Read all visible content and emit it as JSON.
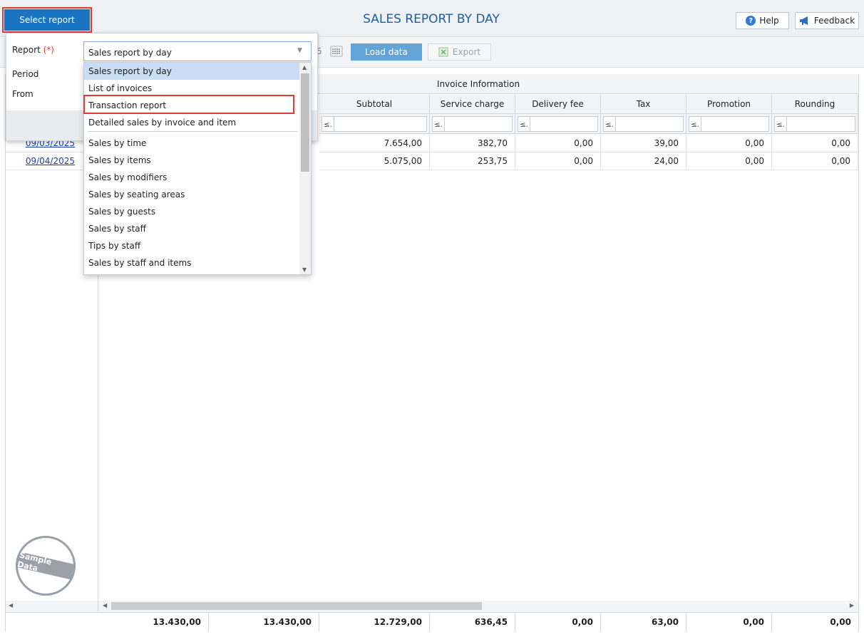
{
  "header": {
    "select_report_label": "Select report",
    "title": "SALES REPORT BY DAY",
    "help_label": "Help",
    "feedback_label": "Feedback"
  },
  "toolbar": {
    "date_tail": "5",
    "load_label": "Load data",
    "export_label": "Export"
  },
  "panel": {
    "report_label": "Report",
    "required_mark": "(*)",
    "period_label": "Period",
    "from_label": "From",
    "report_value": "Sales report by day",
    "dropdown_items": [
      "Sales report by day",
      "List of invoices",
      "Transaction report",
      "Detailed sales by invoice and item",
      "Sales by time",
      "Sales by items",
      "Sales by modifiers",
      "Sales by seating areas",
      "Sales by guests",
      "Sales by staff",
      "Tips by staff",
      "Sales by staff and items"
    ]
  },
  "grid": {
    "group_header": "Invoice Information",
    "columns": [
      "Subtotal",
      "Service charge",
      "Delivery fee",
      "Tax",
      "Promotion",
      "Rounding"
    ],
    "filter_op": "≤.",
    "rows": [
      {
        "date": "09/03/2025",
        "values": [
          "7.654,00",
          "382,70",
          "0,00",
          "39,00",
          "0,00",
          "0,00"
        ]
      },
      {
        "date": "09/04/2025",
        "values": [
          "5.075,00",
          "253,75",
          "0,00",
          "24,00",
          "0,00",
          "0,00"
        ]
      }
    ],
    "totals": [
      "13.430,00",
      "13.430,00",
      "12.729,00",
      "636,45",
      "0,00",
      "63,00",
      "0,00",
      "0,00"
    ]
  },
  "stamp_text": "Sample Data"
}
